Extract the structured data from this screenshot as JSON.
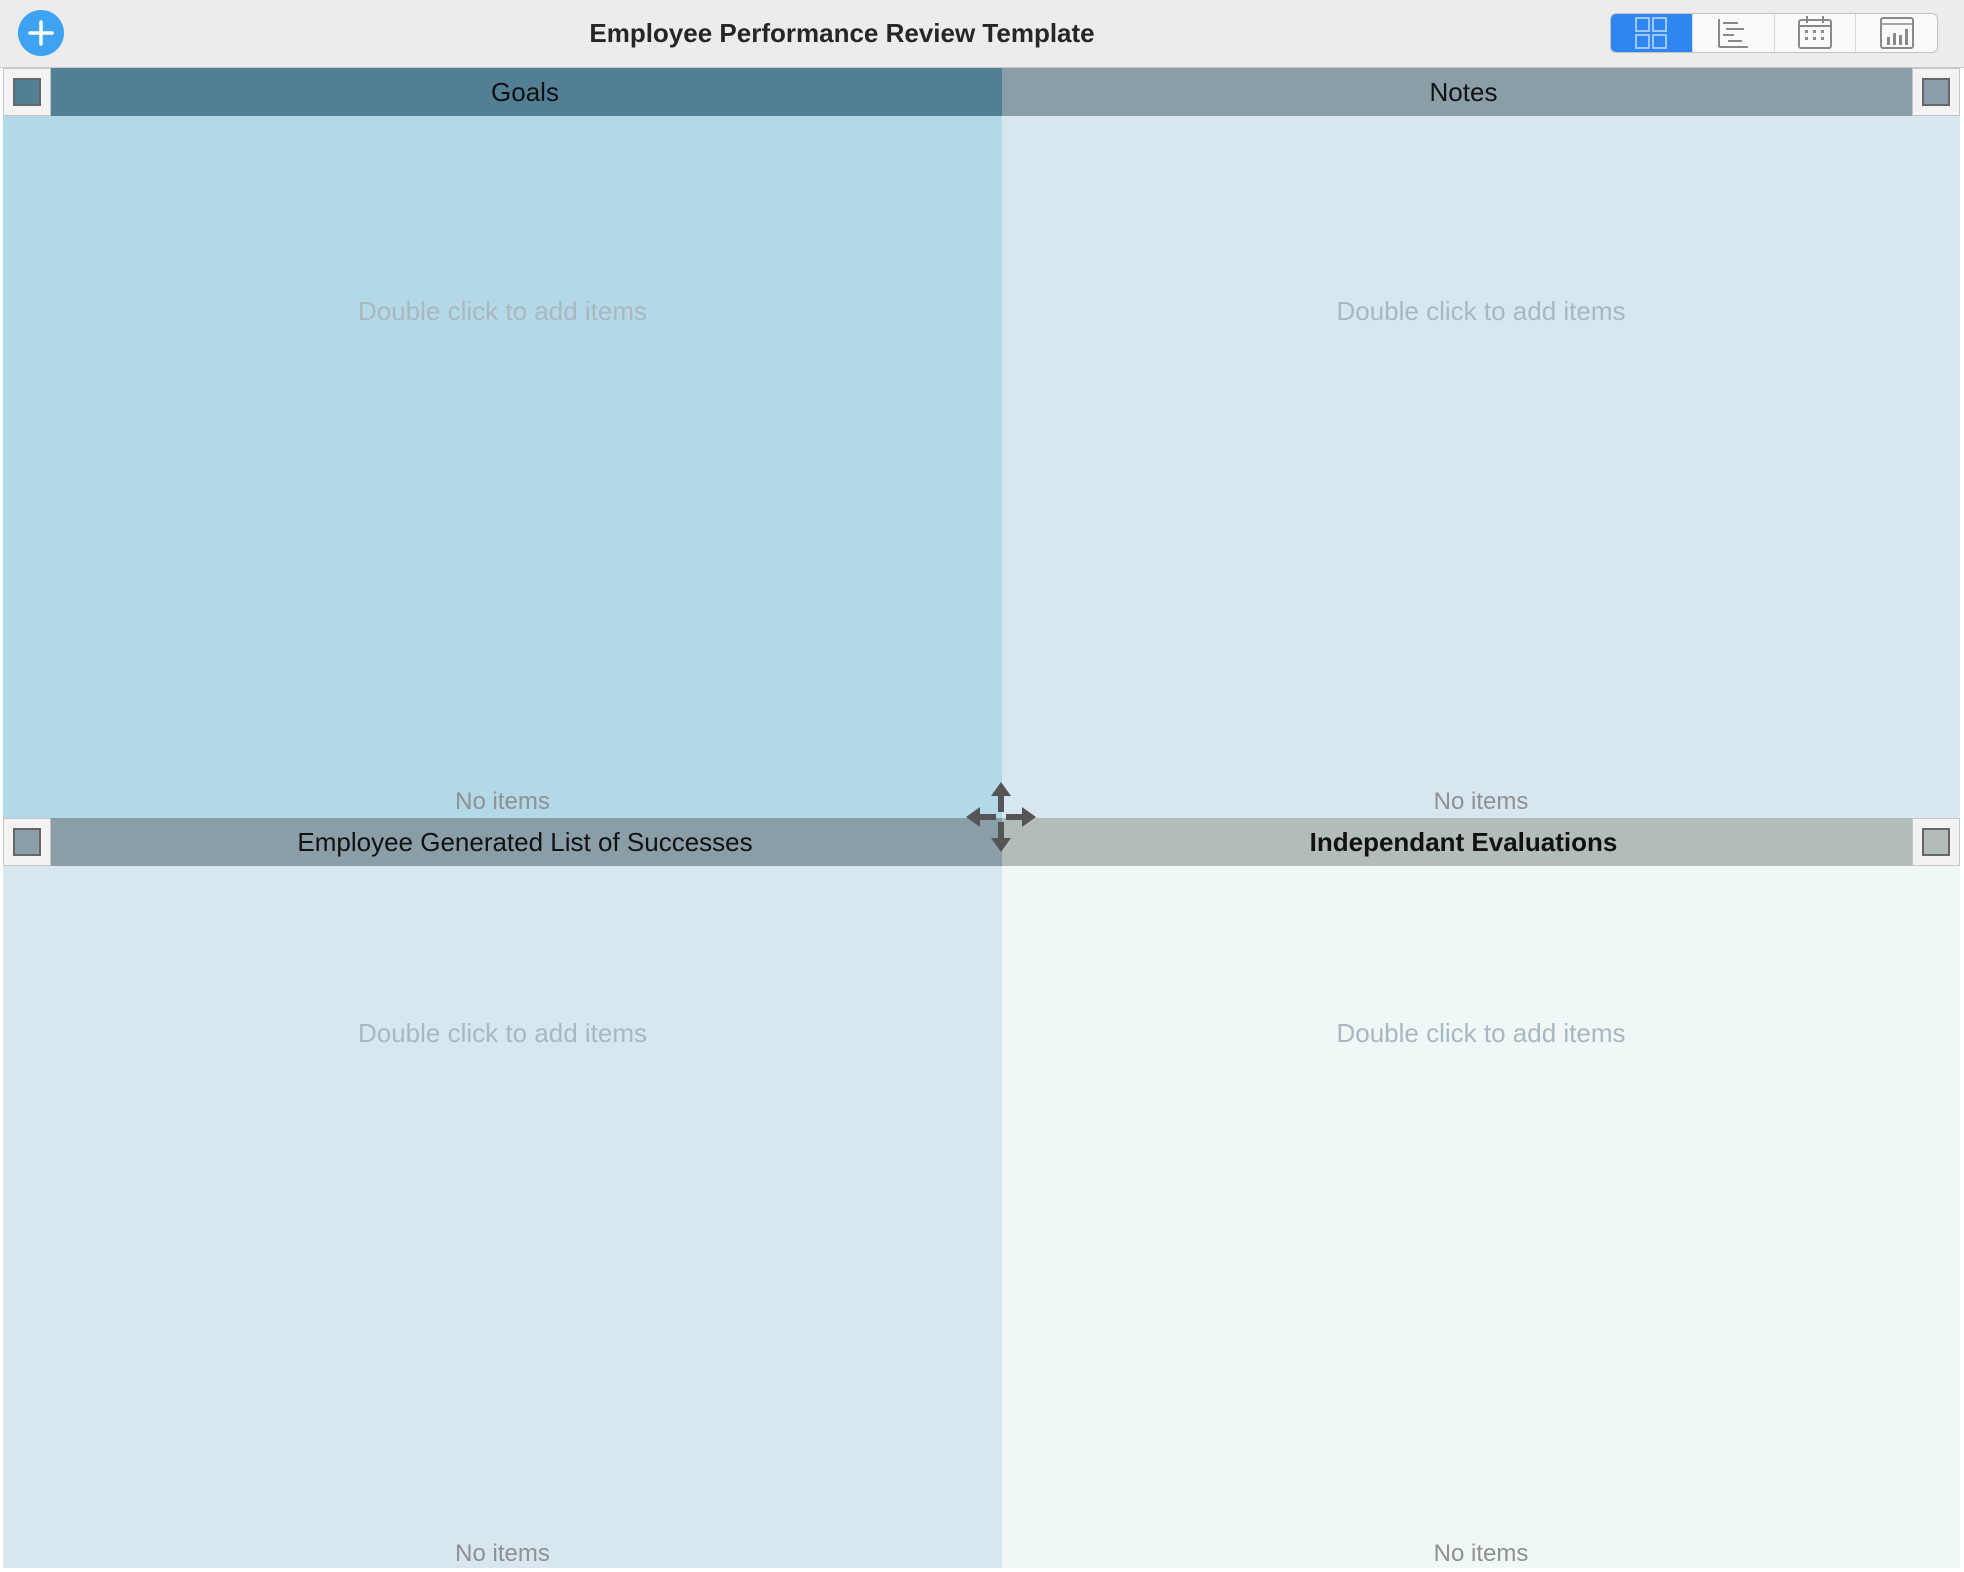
{
  "window": {
    "title": "Employee Performance Review Template"
  },
  "toolbar": {
    "add_icon": "plus-circle-icon",
    "accent_color": "#2f86f0",
    "view_modes": [
      {
        "icon": "grid-view-icon",
        "active": true
      },
      {
        "icon": "outline-view-icon",
        "active": false
      },
      {
        "icon": "calendar-view-icon",
        "active": false
      },
      {
        "icon": "chart-view-icon",
        "active": false
      }
    ]
  },
  "quadrants": [
    {
      "title": "Goals",
      "hint": "Double click to add items",
      "empty_label": "No items",
      "header_color": "#537f95",
      "body_color": "#b3d8e7"
    },
    {
      "title": "Notes",
      "hint": "Double click to add items",
      "empty_label": "No items",
      "header_color": "#8a9ea8",
      "body_color": "#d8e7ef"
    },
    {
      "title": "Employee Generated List of Successes",
      "hint": "Double click to add items",
      "empty_label": "No items",
      "header_color": "#8a9ea8",
      "body_color": "#d8e7ef"
    },
    {
      "title": "Independant Evaluations",
      "hint": "Double click to add items",
      "empty_label": "No items",
      "header_color": "#b2bdba",
      "body_color": "#eff7f7"
    }
  ],
  "center_handle": {
    "icon": "move-arrows-icon"
  }
}
